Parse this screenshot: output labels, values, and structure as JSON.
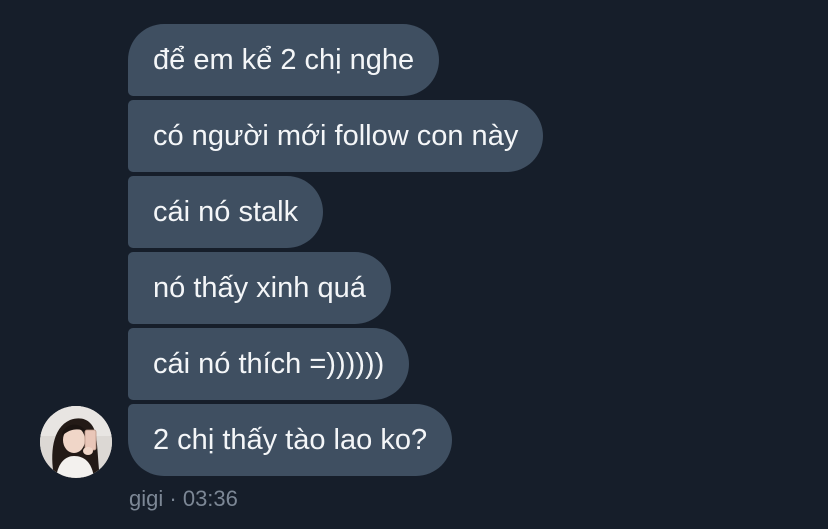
{
  "messages": [
    {
      "text": "để em kể 2 chị nghe"
    },
    {
      "text": "có người mới follow con này"
    },
    {
      "text": "cái nó stalk"
    },
    {
      "text": "nó thấy xinh quá"
    },
    {
      "text": "cái nó thích =))))))"
    },
    {
      "text": "2 chị thấy tào lao ko?"
    }
  ],
  "sender": {
    "name": "gigi",
    "separator": "·",
    "time": "03:36",
    "avatar_icon": "user-avatar-photo"
  },
  "colors": {
    "background": "#161e2a",
    "bubble": "#3f4f61",
    "bubble_text": "#f4f6f8",
    "meta_text": "#7c8795"
  }
}
